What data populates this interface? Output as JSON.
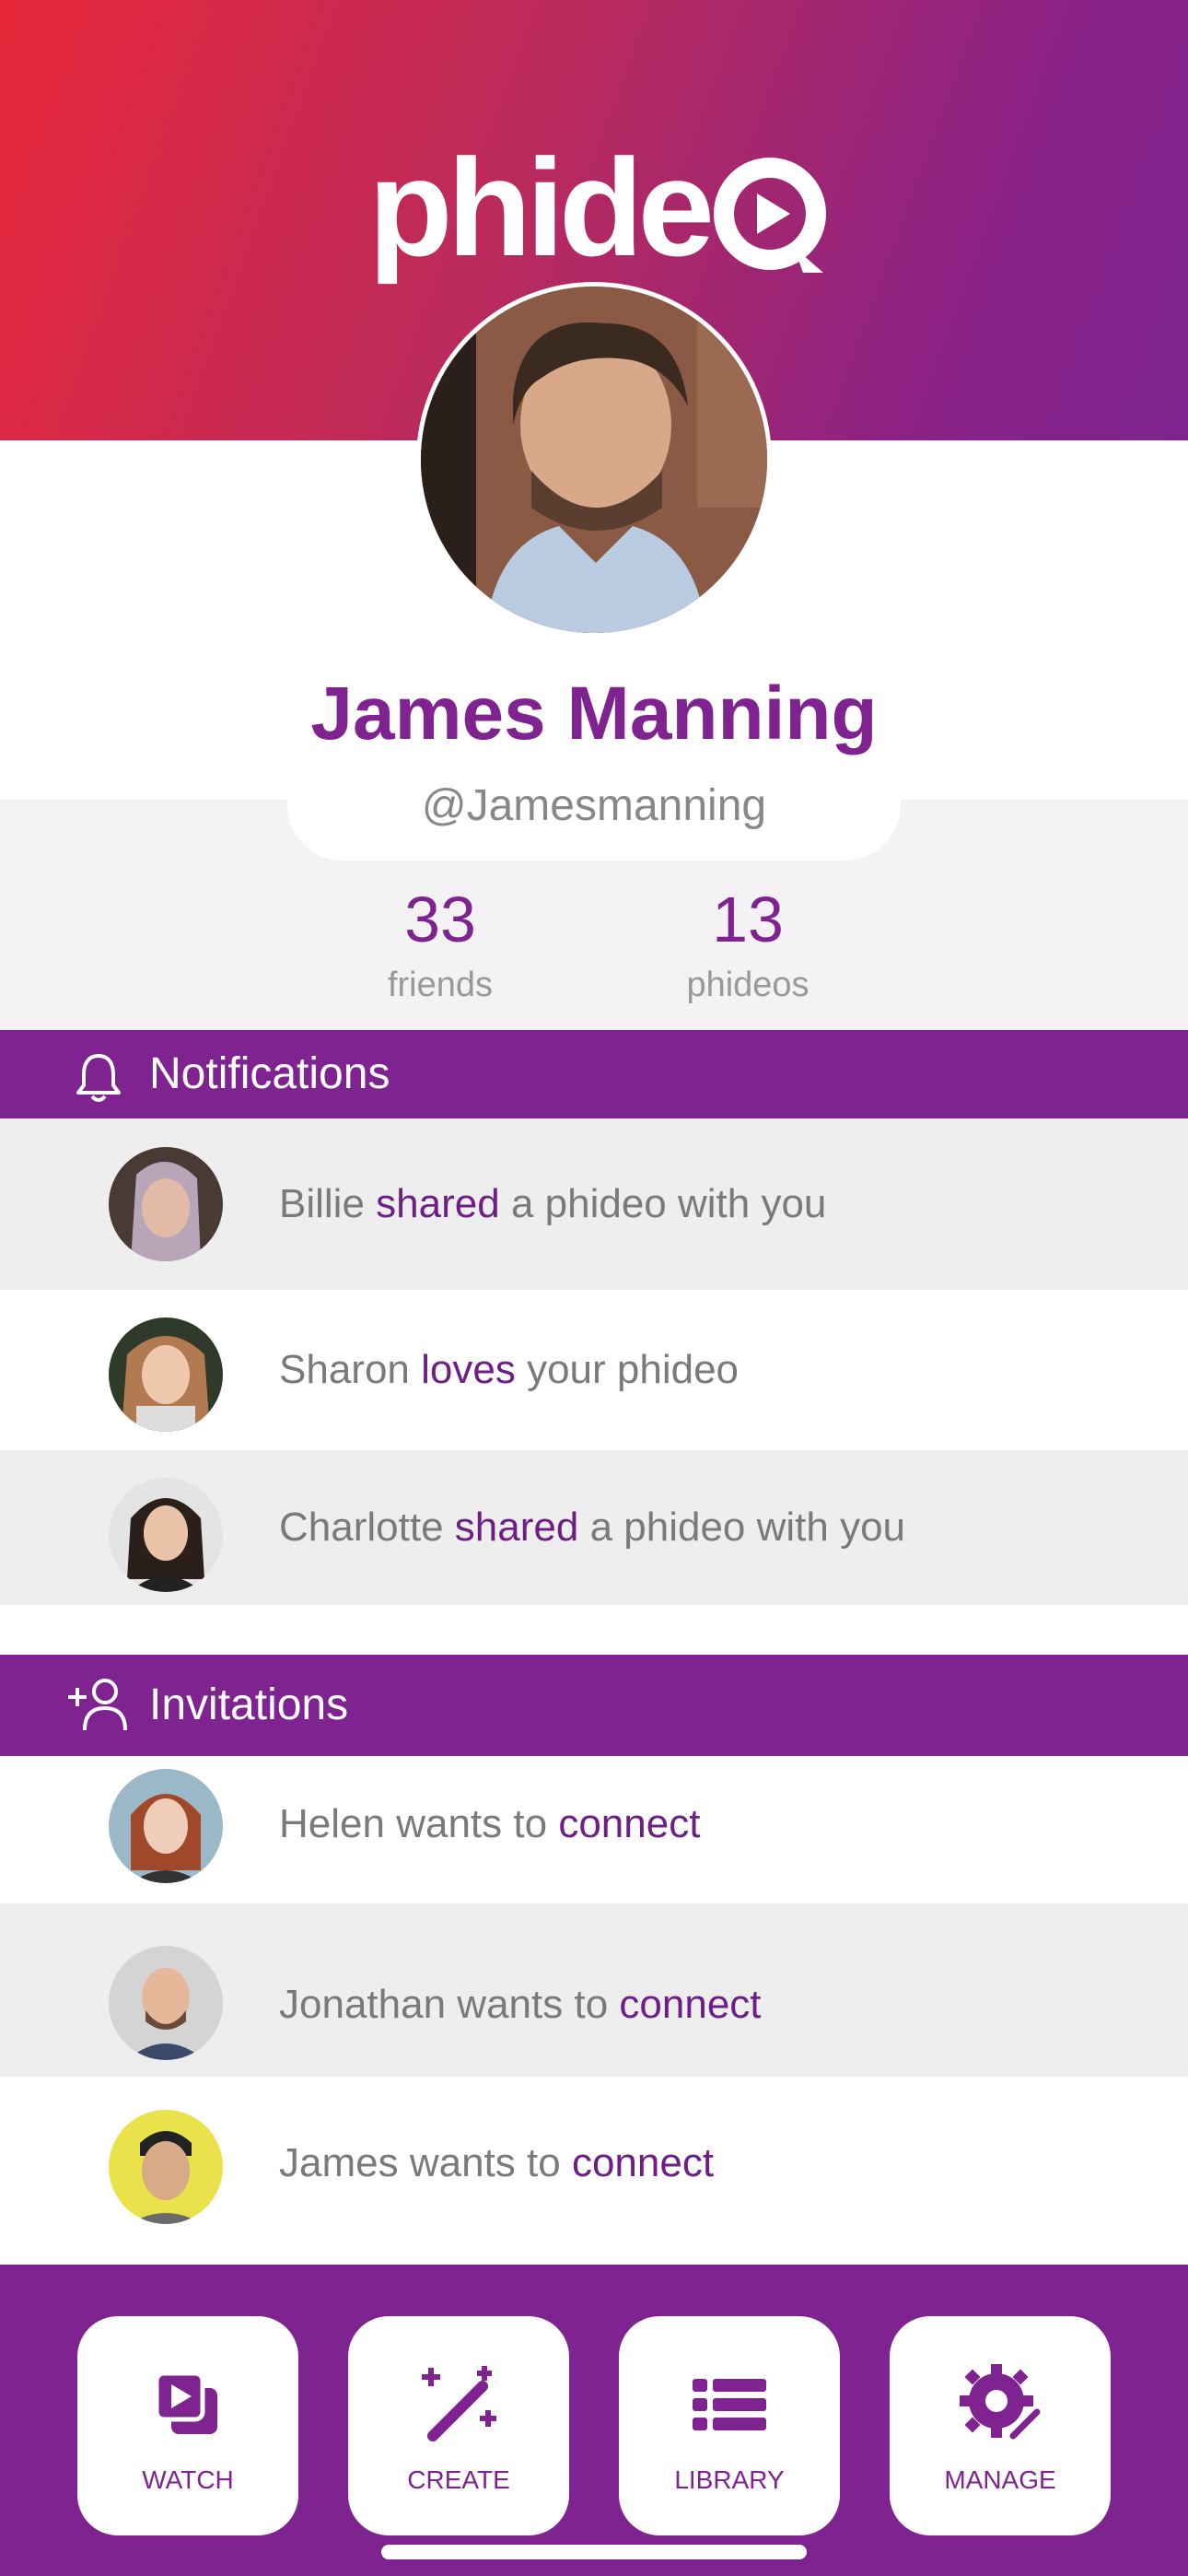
{
  "app": {
    "logo_text": "phide",
    "brand_color": "#7e2390",
    "accent_color": "#6d1f86"
  },
  "profile": {
    "name": "James Manning",
    "handle": "@Jamesmanning",
    "avatar_icon": "profile-photo"
  },
  "stats": [
    {
      "value": "33",
      "label": "friends"
    },
    {
      "value": "13",
      "label": "phideos"
    }
  ],
  "notifications": {
    "title": "Notifications",
    "icon": "bell-icon",
    "items": [
      {
        "who": "Billie",
        "verb": "shared",
        "rest": "a phideo with you"
      },
      {
        "who": "Sharon",
        "verb": "loves",
        "rest": "your phideo"
      },
      {
        "who": "Charlotte",
        "verb": "shared",
        "rest": "a phideo with you"
      }
    ]
  },
  "invitations": {
    "title": "Invitations",
    "icon": "add-user-icon",
    "items": [
      {
        "who": "Helen",
        "mid": "wants to",
        "action": "connect"
      },
      {
        "who": "Jonathan",
        "mid": "wants to",
        "action": "connect"
      },
      {
        "who": "James",
        "mid": "wants to",
        "action": "connect"
      }
    ]
  },
  "nav": [
    {
      "label": "WATCH",
      "icon": "watch-icon"
    },
    {
      "label": "CREATE",
      "icon": "create-icon"
    },
    {
      "label": "LIBRARY",
      "icon": "library-icon"
    },
    {
      "label": "MANAGE",
      "icon": "manage-icon"
    }
  ]
}
